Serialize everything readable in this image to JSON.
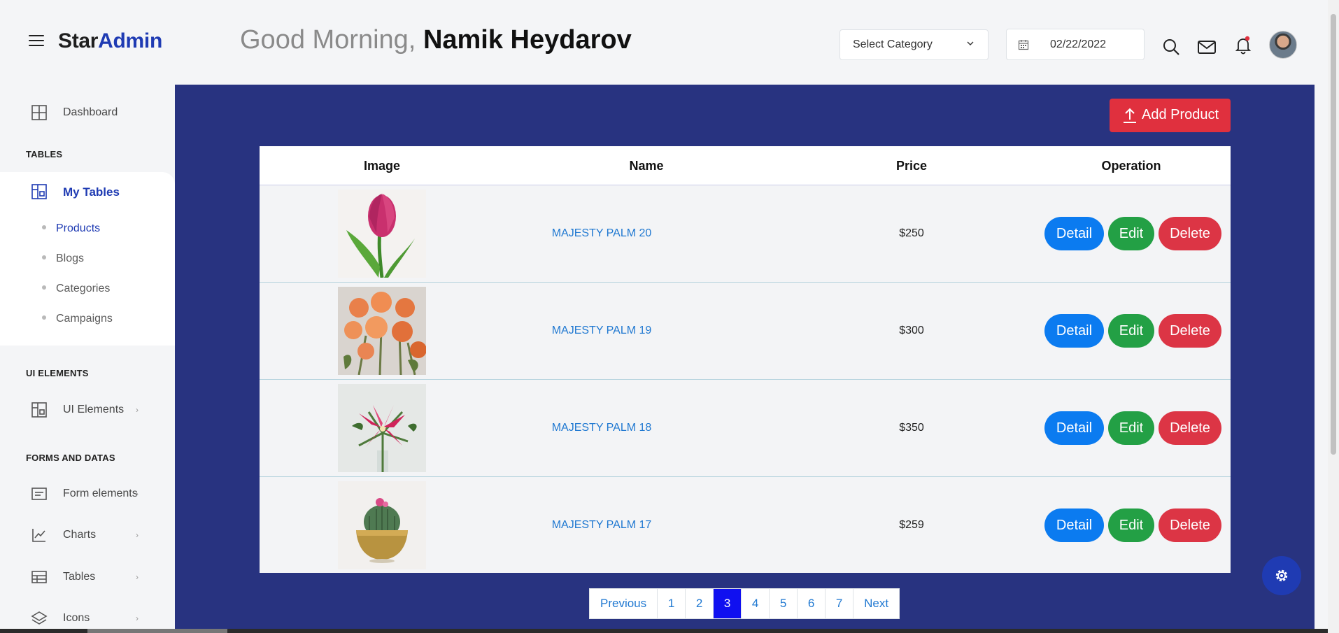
{
  "header": {
    "brand_part1": "Star",
    "brand_part2": "Admin",
    "greeting_prefix": "Good Morning,",
    "greeting_name": "Namik Heydarov",
    "category_select": "Select Category",
    "date_value": "02/22/2022"
  },
  "sidebar": {
    "dashboard": "Dashboard",
    "section_tables": "TABLES",
    "my_tables": "My Tables",
    "sub_items": [
      "Products",
      "Blogs",
      "Categories",
      "Campaigns"
    ],
    "section_ui": "UI ELEMENTS",
    "ui_elements": "UI Elements",
    "section_forms": "FORMS AND DATAS",
    "form_elements": "Form elements",
    "charts": "Charts",
    "tables": "Tables",
    "icons": "Icons"
  },
  "main": {
    "add_product": "Add Product",
    "columns": [
      "Image",
      "Name",
      "Price",
      "Operation"
    ],
    "rows": [
      {
        "name": "MAJESTY PALM 20",
        "price": "$250",
        "image": "pink-tulip"
      },
      {
        "name": "MAJESTY PALM 19",
        "price": "$300",
        "image": "orange-roses"
      },
      {
        "name": "MAJESTY PALM 18",
        "price": "$350",
        "image": "pink-lily"
      },
      {
        "name": "MAJESTY PALM 17",
        "price": "$259",
        "image": "cactus-in-gold-pot"
      }
    ],
    "actions": {
      "detail": "Detail",
      "edit": "Edit",
      "delete": "Delete"
    },
    "pagination": {
      "previous": "Previous",
      "pages": [
        "1",
        "2",
        "3",
        "4",
        "5",
        "6",
        "7"
      ],
      "current": "3",
      "next": "Next"
    }
  },
  "colors": {
    "brand_blue": "#1f3bb3",
    "main_bg": "#283380",
    "danger": "#dc3545",
    "success": "#23a045",
    "primary": "#0b7bf0"
  }
}
